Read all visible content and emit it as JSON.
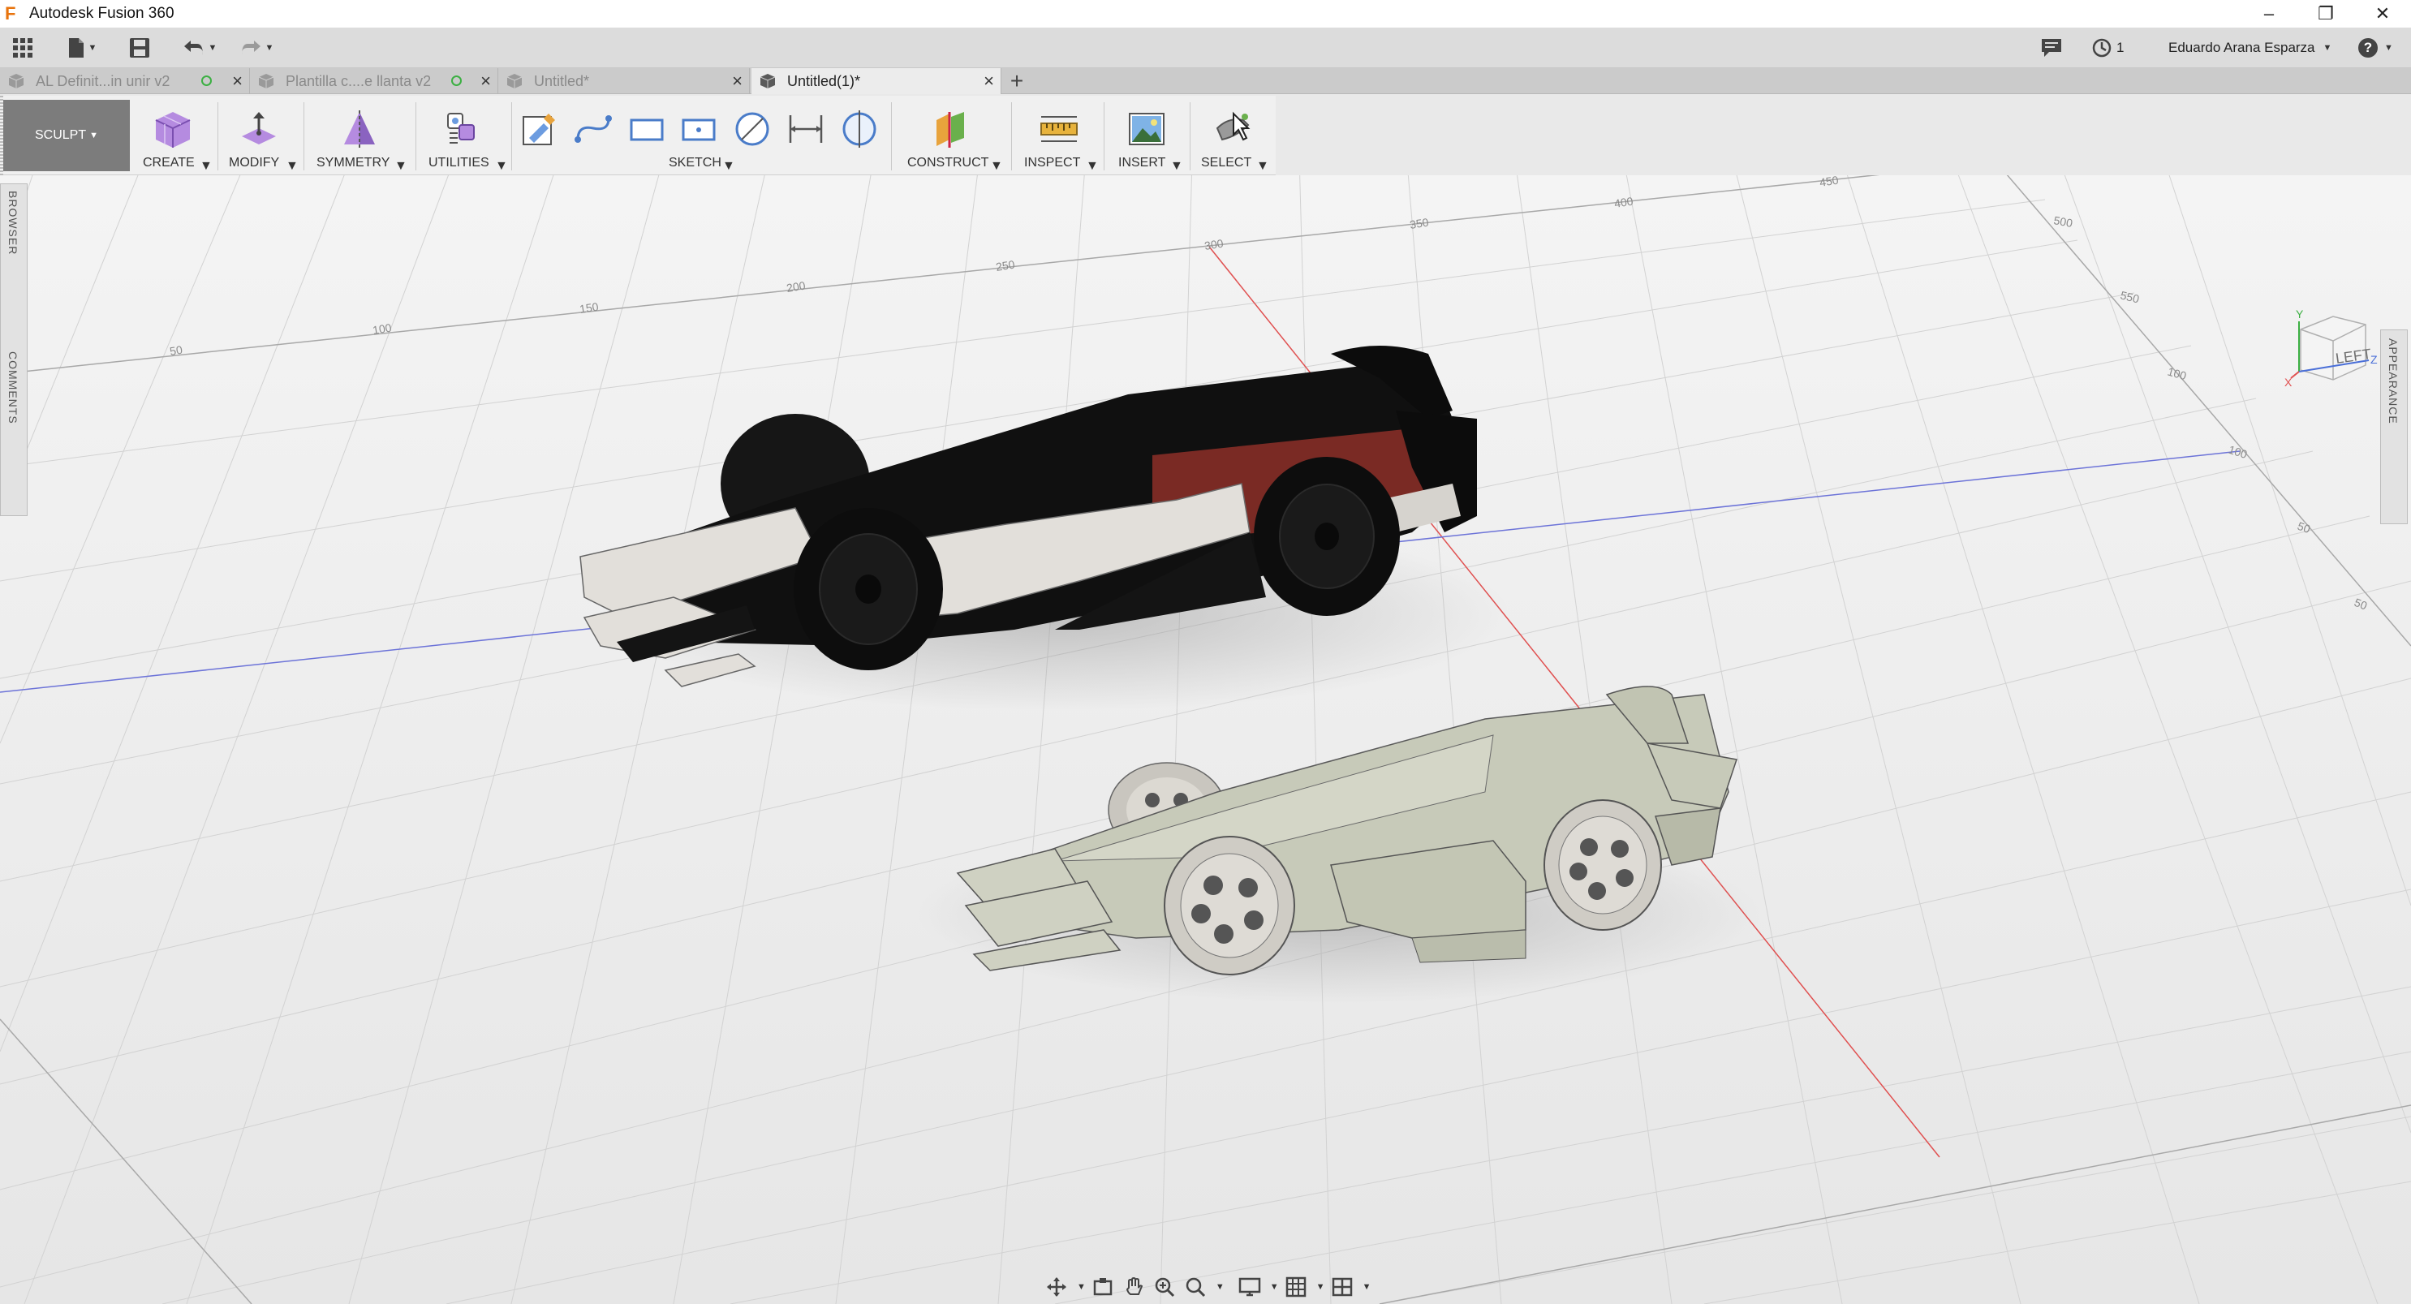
{
  "window": {
    "app_title": "Autodesk Fusion 360",
    "logo_text": "F",
    "controls": {
      "minimize": "–",
      "restore": "❐",
      "close": "✕"
    }
  },
  "quick_access": {
    "job_status": "1",
    "user_name": "Eduardo Arana Esparza",
    "help": "?"
  },
  "tabs": [
    {
      "label": "AL Definit...in unir v2",
      "active": false,
      "saved": true
    },
    {
      "label": "Plantilla c....e llanta v2",
      "active": false,
      "saved": true
    },
    {
      "label": "Untitled*",
      "active": false,
      "saved": false
    },
    {
      "label": "Untitled(1)*",
      "active": true,
      "saved": false
    }
  ],
  "new_tab": "+",
  "toolbar": {
    "workspace": "SCULPT",
    "create": "CREATE",
    "modify": "MODIFY",
    "symmetry": "SYMMETRY",
    "utilities": "UTILITIES",
    "sketch": "SKETCH",
    "construct": "CONSTRUCT",
    "inspect": "INSPECT",
    "insert": "INSERT",
    "select": "SELECT"
  },
  "side_panels": {
    "browser": "BROWSER",
    "comments": "COMMENTS",
    "appearance": "APPEARANCE"
  },
  "viewcube": {
    "face": "LEFT",
    "axis_x": "X",
    "axis_y": "Y",
    "axis_z": "Z"
  },
  "grid_labels": [
    "50",
    "100",
    "150",
    "200",
    "250",
    "300",
    "350",
    "400",
    "450",
    "500",
    "550",
    "100",
    "100",
    "50",
    "50",
    "100"
  ],
  "colors": {
    "accent_orange": "#e8730c",
    "red_axis": "#e05050",
    "blue_axis": "#6c73d8",
    "grid": "#cfcfcf",
    "car_black": "#121212",
    "car_white": "#e4e1dc",
    "car_sage": "#c6c9b8"
  },
  "icons": [
    "grid-menu-icon",
    "file-icon",
    "save-icon",
    "undo-icon",
    "redo-icon",
    "comment-icon",
    "clock-icon",
    "help-icon",
    "orbit-icon",
    "pan-icon",
    "zoom-icon",
    "display-icon",
    "grid-icon",
    "viewports-icon"
  ]
}
